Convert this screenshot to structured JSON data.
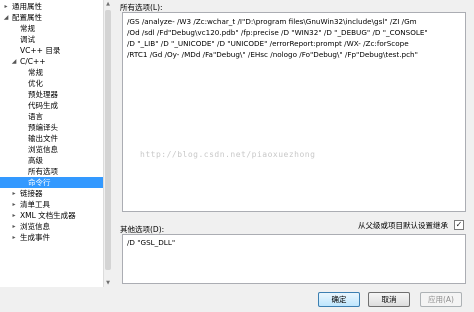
{
  "tree": {
    "items": [
      {
        "label": "通用属性",
        "arrow": "▸",
        "level": 0
      },
      {
        "label": "配置属性",
        "arrow": "◢",
        "level": 0
      },
      {
        "label": "常规",
        "arrow": "",
        "level": 1
      },
      {
        "label": "调试",
        "arrow": "",
        "level": 1
      },
      {
        "label": "VC++ 目录",
        "arrow": "",
        "level": 1
      },
      {
        "label": "C/C++",
        "arrow": "◢",
        "level": 1
      },
      {
        "label": "常规",
        "arrow": "",
        "level": 2
      },
      {
        "label": "优化",
        "arrow": "",
        "level": 2
      },
      {
        "label": "预处理器",
        "arrow": "",
        "level": 2
      },
      {
        "label": "代码生成",
        "arrow": "",
        "level": 2
      },
      {
        "label": "语言",
        "arrow": "",
        "level": 2
      },
      {
        "label": "预编译头",
        "arrow": "",
        "level": 2
      },
      {
        "label": "输出文件",
        "arrow": "",
        "level": 2
      },
      {
        "label": "浏览信息",
        "arrow": "",
        "level": 2
      },
      {
        "label": "高级",
        "arrow": "",
        "level": 2
      },
      {
        "label": "所有选项",
        "arrow": "",
        "level": 2
      },
      {
        "label": "命令行",
        "arrow": "",
        "level": 2,
        "selected": true
      },
      {
        "label": "链接器",
        "arrow": "▸",
        "level": 1
      },
      {
        "label": "清单工具",
        "arrow": "▸",
        "level": 1
      },
      {
        "label": "XML 文档生成器",
        "arrow": "▸",
        "level": 1
      },
      {
        "label": "浏览信息",
        "arrow": "▸",
        "level": 1
      },
      {
        "label": "生成事件",
        "arrow": "▸",
        "level": 1
      }
    ]
  },
  "all_options": {
    "label": "所有选项(L):",
    "lines": [
      "/GS /analyze- /W3 /Zc:wchar_t /I\"D:\\program files\\GnuWin32\\include\\gsl\" /ZI /Gm",
      "/Od /sdl /Fd\"Debug\\vc120.pdb\" /fp:precise /D \"WIN32\" /D \"_DEBUG\" /D \"_CONSOLE\"",
      "/D \"_LIB\" /D \"_UNICODE\" /D \"UNICODE\" /errorReport:prompt /WX- /Zc:forScope",
      "/RTC1 /Gd /Oy- /MDd /Fa\"Debug\\\" /EHsc /nologo /Fo\"Debug\\\" /Fp\"Debug\\test.pch\""
    ]
  },
  "watermark": "http://blog.csdn.net/piaoxuezhong",
  "inherit": {
    "label": "从父级或项目默认设置继承",
    "checked": "✓"
  },
  "other_options": {
    "label": "其他选项(D):",
    "value": "/D \"GSL_DLL\""
  },
  "buttons": {
    "ok": "确定",
    "cancel": "取消",
    "apply": "应用(A)"
  }
}
